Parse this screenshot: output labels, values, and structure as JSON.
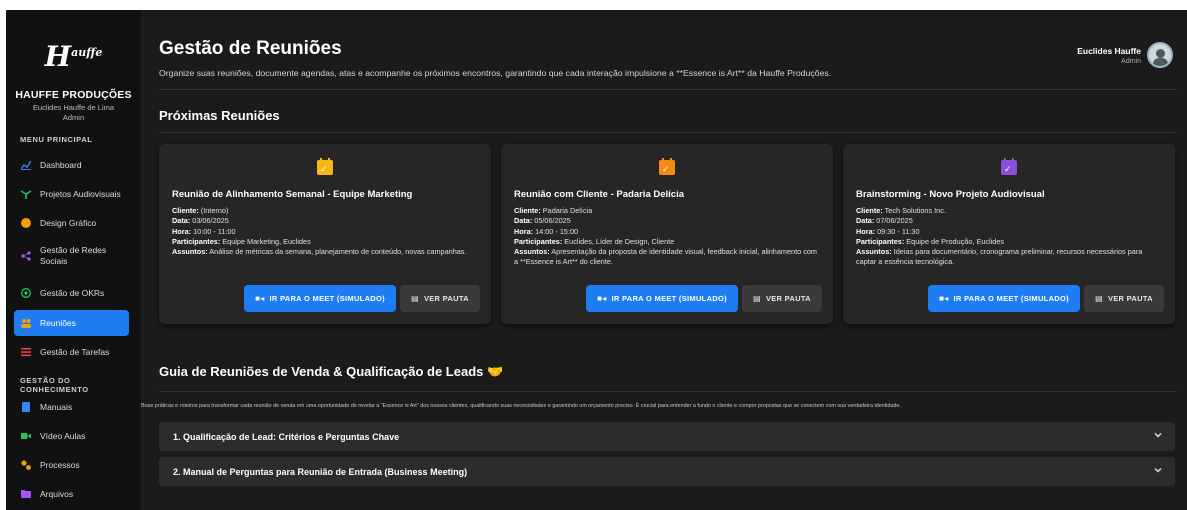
{
  "sidebar": {
    "logo_main": "H",
    "logo_sup": "auffe",
    "brand": "HAUFFE PRODUÇÕES",
    "user_line1": "Euclides Hauffe de Lima",
    "user_line2": "Admin",
    "menu_label": "MENU PRINCIPAL",
    "knowledge_label": "GESTÃO DO CONHECIMENTO",
    "items": [
      {
        "label": "Dashboard",
        "icon": "chart-line-icon",
        "color": "#3b82f6"
      },
      {
        "label": "Projetos Audiovisuais",
        "icon": "film-icon",
        "color": "#22c55e"
      },
      {
        "label": "Design Gráfico",
        "icon": "palette-icon",
        "color": "#f59e0b"
      },
      {
        "label": "Gestão de Redes Sociais",
        "icon": "share-icon",
        "color": "#a855f7"
      },
      {
        "label": "Gestão de OKRs",
        "icon": "target-icon",
        "color": "#22c55e"
      },
      {
        "label": "Reuniões",
        "icon": "people-icon",
        "color": "#f59e0b"
      },
      {
        "label": "Gestão de Tarefas",
        "icon": "list-icon",
        "color": "#ef4444"
      }
    ],
    "knowledge_items": [
      {
        "label": "Manuais",
        "icon": "book-icon",
        "color": "#3b82f6"
      },
      {
        "label": "Vídeo Aulas",
        "icon": "video-icon",
        "color": "#22c55e"
      },
      {
        "label": "Processos",
        "icon": "gears-icon",
        "color": "#f59e0b"
      },
      {
        "label": "Arquivos",
        "icon": "folder-icon",
        "color": "#a855f7"
      }
    ]
  },
  "header": {
    "title": "Gestão de Reuniões",
    "subtitle": "Organize suas reuniões, documente agendas, atas e acompanhe os próximos encontros, garantindo que cada interação impulsione a **Essence is Art** da Hauffe Produções.",
    "user_name": "Euclides Hauffe",
    "user_role": "Admin"
  },
  "upcoming": {
    "title": "Próximas Reuniões",
    "meet_label": "IR PARA O MEET (SIMULADO)",
    "pauta_label": "VER PAUTA",
    "cards": [
      {
        "icon_color": "#f5b914",
        "title": "Reunião de Alinhamento Semanal - Equipe Marketing",
        "cliente_k": "Cliente:",
        "cliente": " (Interno)",
        "data_k": "Data:",
        "data": " 03/06/2025",
        "hora_k": "Hora:",
        "hora": " 10:00 - 11:00",
        "part_k": "Participantes:",
        "part": " Equipe Marketing, Euclides",
        "assuntos_k": "Assuntos:",
        "assuntos": " Análise de métricas da semana, planejamento de conteúdo, novas campanhas."
      },
      {
        "icon_color": "#f58a14",
        "title": "Reunião com Cliente - Padaria Delícia",
        "cliente_k": "Cliente:",
        "cliente": " Padaria Delícia",
        "data_k": "Data:",
        "data": " 05/06/2025",
        "hora_k": "Hora:",
        "hora": " 14:00 - 15:00",
        "part_k": "Participantes:",
        "part": " Euclides, Líder de Design, Cliente",
        "assuntos_k": "Assuntos:",
        "assuntos": " Apresentação da proposta de identidade visual, feedback inicial, alinhamento com a **Essence is Art** do cliente."
      },
      {
        "icon_color": "#8b4fd9",
        "title": "Brainstorming - Novo Projeto Audiovisual",
        "cliente_k": "Cliente:",
        "cliente": " Tech Solutions Inc.",
        "data_k": "Data:",
        "data": " 07/06/2025",
        "hora_k": "Hora:",
        "hora": " 09:30 - 11:30",
        "part_k": "Participantes:",
        "part": " Equipe de Produção, Euclides",
        "assuntos_k": "Assuntos:",
        "assuntos": " Ideias para documentário, cronograma preliminar, recursos necessários para captar a essência tecnológica."
      }
    ]
  },
  "guide": {
    "title": "Guia de Reuniões de Venda & Qualificação de Leads",
    "emoji": "🤝",
    "description": "Boas práticas e roteiros para transformar cada reunião de venda em uma oportunidade de revelar a \"Essence is Art\" dos nossos clientes, qualificando suas necessidades e garantindo um orçamento preciso. É crucial para entender a fundo o cliente e compor propostas que se conectem com sua verdadeira identidade.",
    "accordions": [
      {
        "label": "1. Qualificação de Lead: Critérios e Perguntas Chave"
      },
      {
        "label": "2. Manual de Perguntas para Reunião de Entrada (Business Meeting)"
      }
    ]
  }
}
